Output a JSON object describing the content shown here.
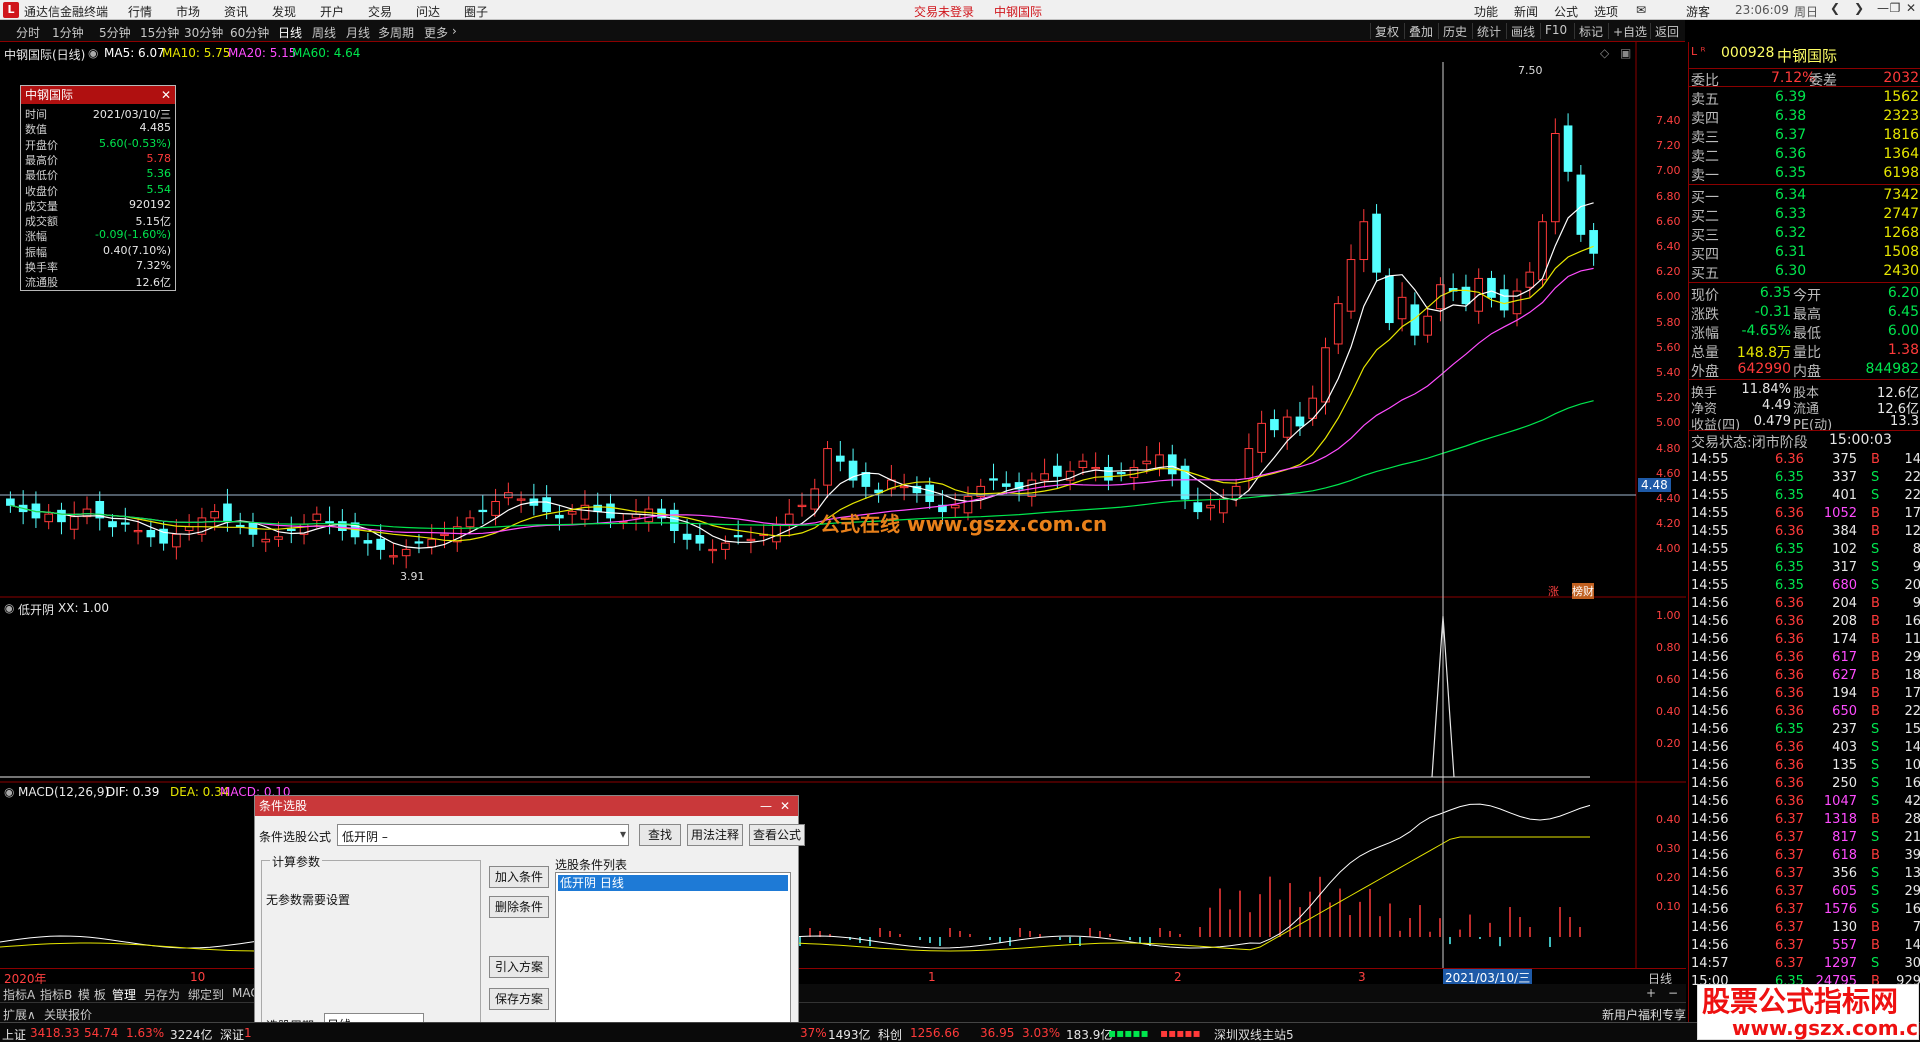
{
  "menubar": {
    "app_name": "通达信金融终端",
    "items": [
      "行情",
      "市场",
      "资讯",
      "发现",
      "开户",
      "交易",
      "问达",
      "圈子"
    ],
    "trade_status": "交易未登录",
    "stock_name_red": "中钢国际",
    "right_items": [
      "功能",
      "新闻",
      "公式",
      "选项"
    ],
    "guest": "游客",
    "time": "23:06:09",
    "weekday": "周日"
  },
  "toolbar": {
    "periods": [
      "分时",
      "1分钟",
      "5分钟",
      "15分钟",
      "30分钟",
      "60分钟",
      "日线",
      "周线",
      "月线",
      "多周期",
      "更多"
    ],
    "selected": "日线",
    "right": [
      "复权",
      "叠加",
      "历史",
      "统计",
      "画线",
      "F10",
      "标记",
      "+自选",
      "返回"
    ]
  },
  "chart": {
    "title": "中钢国际(日线)",
    "ma": [
      {
        "label": "MA5: 6.07",
        "color": "#ffffff"
      },
      {
        "label": "MA10: 5.75",
        "color": "#e6e600"
      },
      {
        "label": "MA20: 5.15",
        "color": "#ff4cff"
      },
      {
        "label": "MA60: 4.64",
        "color": "#00e64e"
      }
    ],
    "price_axis": [
      "7.40",
      "7.20",
      "7.00",
      "6.80",
      "6.60",
      "6.40",
      "6.20",
      "6.00",
      "5.80",
      "5.60",
      "5.40",
      "5.20",
      "5.00",
      "4.80",
      "4.60",
      "4.40",
      "4.20",
      "4.00"
    ],
    "cursor_price": "4.48",
    "high_label": "7.50",
    "low_label": "3.91",
    "site_text": "公式在线 www.gszx.com.cn",
    "tags": [
      "涨",
      "榜财"
    ]
  },
  "chart_data": {
    "type": "candlestick",
    "y_range": [
      3.9,
      7.55
    ],
    "closes": [
      4.35,
      4.3,
      4.25,
      4.28,
      4.22,
      4.26,
      4.32,
      4.25,
      4.18,
      4.2,
      4.15,
      4.1,
      4.05,
      4.12,
      4.18,
      4.25,
      4.3,
      4.22,
      4.18,
      4.12,
      4.08,
      4.1,
      4.15,
      4.2,
      4.28,
      4.22,
      4.15,
      4.1,
      4.05,
      4.0,
      3.95,
      4.0,
      4.05,
      4.08,
      4.12,
      4.18,
      4.25,
      4.3,
      4.38,
      4.45,
      4.4,
      4.35,
      4.3,
      4.25,
      4.3,
      4.35,
      4.3,
      4.25,
      4.22,
      4.28,
      4.32,
      4.25,
      4.15,
      4.08,
      4.05,
      4.0,
      4.05,
      4.1,
      4.08,
      4.12,
      4.2,
      4.28,
      4.35,
      4.48,
      4.8,
      4.7,
      4.55,
      4.5,
      4.45,
      4.55,
      4.5,
      4.45,
      4.38,
      4.3,
      4.35,
      4.42,
      4.5,
      4.55,
      4.5,
      4.48,
      4.55,
      4.6,
      4.58,
      4.62,
      4.7,
      4.65,
      4.55,
      4.6,
      4.65,
      4.7,
      4.75,
      4.6,
      4.4,
      4.3,
      4.35,
      4.4,
      4.5,
      4.8,
      5.0,
      4.95,
      5.05,
      4.98,
      5.2,
      5.6,
      5.95,
      6.3,
      6.6,
      6.2,
      5.8,
      6.0,
      5.7,
      5.85,
      6.1,
      6.05,
      5.95,
      6.15,
      6.0,
      5.9,
      6.05,
      6.2,
      6.6,
      7.3,
      7.0,
      6.5,
      6.35
    ]
  },
  "sub1": {
    "title": "低开阴",
    "value": "XX: 1.00",
    "axis": [
      "1.00",
      "0.80",
      "0.60",
      "0.40",
      "0.20"
    ]
  },
  "sub2": {
    "title": "MACD(12,26,9)",
    "dif": "DIF: 0.39",
    "dea": "DEA: 0.34",
    "macd": "MACD: 0.10",
    "axis": [
      "0.40",
      "0.30",
      "0.20",
      "0.10"
    ]
  },
  "time_axis": {
    "labels": [
      "2020年",
      "10",
      "1",
      "2",
      "3"
    ],
    "cursor_date": "2021/03/10/三",
    "period": "日线"
  },
  "bottom_tabs": [
    "指标A",
    "指标B",
    "模 板",
    "管理",
    "另存为",
    "绑定到",
    "MAC"
  ],
  "bottom_tabs2": [
    "扩展∧",
    "关联报价"
  ],
  "popup": {
    "title": "中钢国际",
    "rows": [
      {
        "k": "时间",
        "v": "2021/03/10/三",
        "c": "wht"
      },
      {
        "k": "数值",
        "v": "4.485",
        "c": "wht"
      },
      {
        "k": "开盘价",
        "v": "5.60(-0.53%)",
        "c": "green"
      },
      {
        "k": "最高价",
        "v": "5.78",
        "c": "red2"
      },
      {
        "k": "最低价",
        "v": "5.36",
        "c": "green"
      },
      {
        "k": "收盘价",
        "v": "5.54",
        "c": "green"
      },
      {
        "k": "成交量",
        "v": "920192",
        "c": "wht"
      },
      {
        "k": "成交额",
        "v": "5.15亿",
        "c": "wht"
      },
      {
        "k": "涨幅",
        "v": "-0.09(-1.60%)",
        "c": "green"
      },
      {
        "k": "振幅",
        "v": "0.40(7.10%)",
        "c": "wht"
      },
      {
        "k": "换手率",
        "v": "7.32%",
        "c": "wht"
      },
      {
        "k": "流通股",
        "v": "12.6亿",
        "c": "wht"
      }
    ]
  },
  "dialog": {
    "title": "条件选股",
    "formula_label": "条件选股公式",
    "formula_value": "低开阴        –",
    "buttons_top": [
      "查找",
      "用法注释",
      "查看公式"
    ],
    "params_title": "计算参数",
    "no_params": "无参数需要设置",
    "list_title": "选股条件列表",
    "list_item": "低开阴    日线",
    "buttons_mid": [
      "加入条件",
      "删除条件",
      "引入方案",
      "保存方案"
    ],
    "period_label": "选股周期:",
    "period_value": "日线"
  },
  "quote": {
    "code": "000928",
    "name": "中钢国际",
    "weibi_label": "委比",
    "weibi": "7.12%",
    "weicha_label": "委差",
    "weicha": "2032",
    "sell": [
      {
        "l": "卖五",
        "p": "6.39",
        "v": "1562"
      },
      {
        "l": "卖四",
        "p": "6.38",
        "v": "2323"
      },
      {
        "l": "卖三",
        "p": "6.37",
        "v": "1816"
      },
      {
        "l": "卖二",
        "p": "6.36",
        "v": "1364"
      },
      {
        "l": "卖一",
        "p": "6.35",
        "v": "6198"
      }
    ],
    "buy": [
      {
        "l": "买一",
        "p": "6.34",
        "v": "7342"
      },
      {
        "l": "买二",
        "p": "6.33",
        "v": "2747"
      },
      {
        "l": "买三",
        "p": "6.32",
        "v": "1268"
      },
      {
        "l": "买四",
        "p": "6.31",
        "v": "1508"
      },
      {
        "l": "买五",
        "p": "6.30",
        "v": "2430"
      }
    ],
    "stats": [
      {
        "l1": "现价",
        "v1": "6.35",
        "c1": "green",
        "l2": "今开",
        "v2": "6.20",
        "c2": "green"
      },
      {
        "l1": "涨跌",
        "v1": "-0.31",
        "c1": "green",
        "l2": "最高",
        "v2": "6.45",
        "c2": "green"
      },
      {
        "l1": "涨幅",
        "v1": "-4.65%",
        "c1": "green",
        "l2": "最低",
        "v2": "6.00",
        "c2": "green"
      },
      {
        "l1": "总量",
        "v1": "148.8万",
        "c1": "yel",
        "l2": "量比",
        "v2": "1.38",
        "c2": "red2"
      },
      {
        "l1": "外盘",
        "v1": "642990",
        "c1": "red2",
        "l2": "内盘",
        "v2": "844982",
        "c2": "green"
      }
    ],
    "stats2": [
      {
        "l1": "换手",
        "v1": "11.84%",
        "l2": "股本",
        "v2": "12.6亿"
      },
      {
        "l1": "净资",
        "v1": "4.49",
        "l2": "流通",
        "v2": "12.6亿"
      },
      {
        "l1": "收益(四)",
        "v1": "0.479",
        "l2": "PE(动)",
        "v2": "13.3"
      }
    ],
    "trade_state": "交易状态:闭市阶段",
    "trade_time": "15:00:03",
    "ticks": [
      [
        "14:55",
        "6.36",
        "375",
        "B",
        "14"
      ],
      [
        "14:55",
        "6.35",
        "337",
        "S",
        "22"
      ],
      [
        "14:55",
        "6.35",
        "401",
        "S",
        "22"
      ],
      [
        "14:55",
        "6.36",
        "1052",
        "B",
        "17"
      ],
      [
        "14:55",
        "6.36",
        "384",
        "B",
        "12"
      ],
      [
        "14:55",
        "6.35",
        "102",
        "S",
        "8"
      ],
      [
        "14:55",
        "6.35",
        "317",
        "S",
        "9"
      ],
      [
        "14:55",
        "6.35",
        "680",
        "S",
        "20"
      ],
      [
        "14:56",
        "6.36",
        "204",
        "B",
        "9"
      ],
      [
        "14:56",
        "6.36",
        "208",
        "B",
        "16"
      ],
      [
        "14:56",
        "6.36",
        "174",
        "B",
        "11"
      ],
      [
        "14:56",
        "6.36",
        "617",
        "B",
        "29"
      ],
      [
        "14:56",
        "6.36",
        "627",
        "B",
        "18"
      ],
      [
        "14:56",
        "6.36",
        "194",
        "B",
        "17"
      ],
      [
        "14:56",
        "6.36",
        "650",
        "B",
        "22"
      ],
      [
        "14:56",
        "6.35",
        "237",
        "S",
        "15"
      ],
      [
        "14:56",
        "6.36",
        "403",
        "S",
        "14"
      ],
      [
        "14:56",
        "6.36",
        "135",
        "S",
        "10"
      ],
      [
        "14:56",
        "6.36",
        "250",
        "S",
        "16"
      ],
      [
        "14:56",
        "6.36",
        "1047",
        "S",
        "42"
      ],
      [
        "14:56",
        "6.37",
        "1318",
        "B",
        "28"
      ],
      [
        "14:56",
        "6.37",
        "817",
        "S",
        "21"
      ],
      [
        "14:56",
        "6.37",
        "618",
        "B",
        "39"
      ],
      [
        "14:56",
        "6.37",
        "356",
        "S",
        "13"
      ],
      [
        "14:56",
        "6.37",
        "605",
        "S",
        "29"
      ],
      [
        "14:56",
        "6.37",
        "1576",
        "S",
        "16"
      ],
      [
        "14:56",
        "6.37",
        "130",
        "B",
        "7"
      ],
      [
        "14:56",
        "6.37",
        "557",
        "B",
        "14"
      ],
      [
        "14:57",
        "6.37",
        "1297",
        "S",
        "30"
      ],
      [
        "15:00",
        "6.35",
        "24795",
        "B",
        "929"
      ]
    ]
  },
  "status": {
    "items": [
      {
        "t": "上证",
        "c": "wht"
      },
      {
        "t": "3418.33",
        "c": "red2"
      },
      {
        "t": "54.74",
        "c": "red2"
      },
      {
        "t": "1.63%",
        "c": "red2"
      },
      {
        "t": "3224亿",
        "c": "wht"
      },
      {
        "t": "深证",
        "c": "wht"
      },
      {
        "t": "1",
        "c": "red2"
      }
    ],
    "items2": [
      {
        "t": "37%",
        "c": "red2"
      },
      {
        "t": "1493亿",
        "c": "wht"
      },
      {
        "t": "科创",
        "c": "wht"
      },
      {
        "t": "1256.66",
        "c": "red2"
      },
      {
        "t": "36.95",
        "c": "red2"
      },
      {
        "t": "3.03%",
        "c": "red2"
      },
      {
        "t": "183.9亿",
        "c": "wht"
      }
    ],
    "server": "深圳双线主站5",
    "promo": "新用户福利专享"
  },
  "watermark": {
    "line1": "股票公式指标网",
    "line2": "www.gszx.com.cn"
  }
}
